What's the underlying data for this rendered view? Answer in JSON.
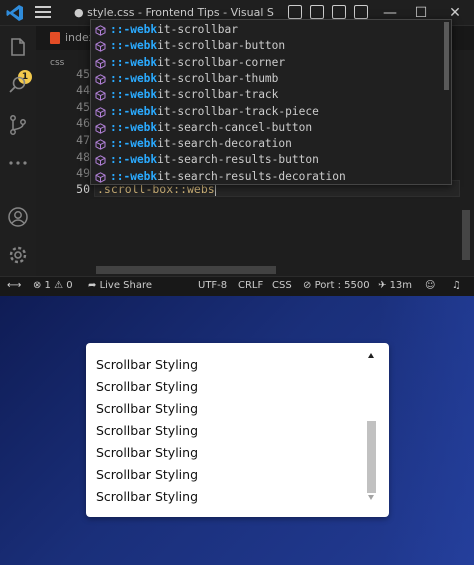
{
  "window": {
    "title": "● style.css - Frontend Tips - Visual Studio C...",
    "controls": {
      "minimize": "—",
      "maximize": "☐",
      "close": "✕"
    }
  },
  "activity": {
    "badge": "1"
  },
  "tabs": [
    {
      "label": "index"
    }
  ],
  "breadcrumb": "css",
  "editor": {
    "line_numbers": [
      "45",
      "44",
      "45",
      "46",
      "47",
      "48",
      "49",
      "50"
    ],
    "current_line_text": ".scroll-box::webs"
  },
  "suggestions": [
    {
      "match": "::-webk",
      "rest": "it-scrollbar"
    },
    {
      "match": "::-webk",
      "rest": "it-scrollbar-button"
    },
    {
      "match": "::-webk",
      "rest": "it-scrollbar-corner"
    },
    {
      "match": "::-webk",
      "rest": "it-scrollbar-thumb"
    },
    {
      "match": "::-webk",
      "rest": "it-scrollbar-track"
    },
    {
      "match": "::-webk",
      "rest": "it-scrollbar-track-piece"
    },
    {
      "match": "::-webk",
      "rest": "it-search-cancel-button"
    },
    {
      "match": "::-webk",
      "rest": "it-search-decoration"
    },
    {
      "match": "::-webk",
      "rest": "it-search-results-button"
    },
    {
      "match": "::-webk",
      "rest": "it-search-results-decoration"
    }
  ],
  "statusbar": {
    "remote": "⟷",
    "problems": "⊗ 1 ⚠ 0",
    "live_share": "Live Share",
    "encoding": "UTF-8",
    "eol": "CRLF",
    "language": "CSS",
    "port": "Port : 5500",
    "time": "13m"
  },
  "preview": {
    "items": [
      "Scrollbar Styling",
      "Scrollbar Styling",
      "Scrollbar Styling",
      "Scrollbar Styling",
      "Scrollbar Styling",
      "Scrollbar Styling",
      "Scrollbar Styling"
    ]
  },
  "colors": {
    "editor_bg": "#1e1e1e",
    "match_highlight": "#2aaaff",
    "suggest_icon": "#b180d7",
    "preview_bg": "#1a2f7a",
    "badge": "#f2c94c"
  }
}
